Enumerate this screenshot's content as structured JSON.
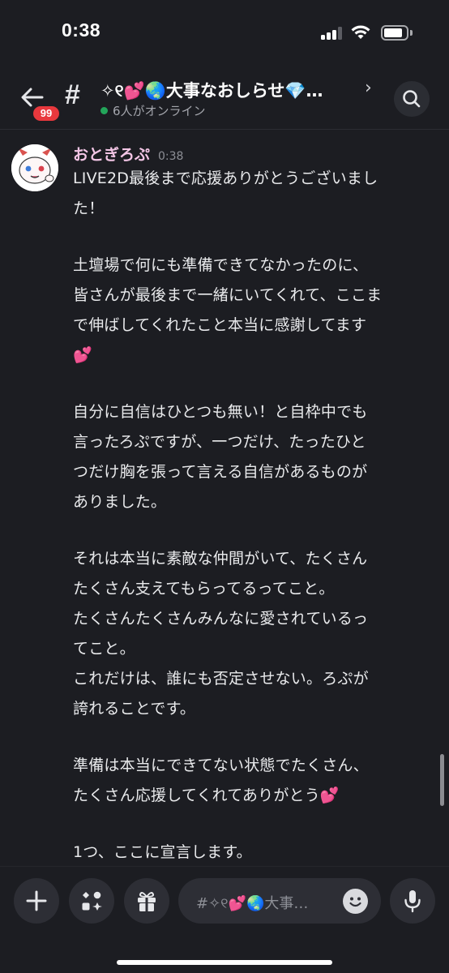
{
  "status_bar": {
    "time": "0:38"
  },
  "header": {
    "unread_badge": "99",
    "channel_name": "✧୧💕🌏大事なおしらせ💎…",
    "online_text": "6人がオンライン"
  },
  "message": {
    "author": "おとぎろぷ",
    "timestamp": "0:38",
    "paragraphs": [
      [
        "LIVE2D最後まで応援ありがとうございまし",
        "た！"
      ],
      [
        "土壇場で何にも準備できてなかったのに、",
        "皆さんが最後まで一緒にいてくれて、ここま",
        "で伸ばしてくれたこと本当に感謝してます",
        "💕"
      ],
      [
        "自分に自信はひとつも無い！と自枠中でも",
        "言ったろぷですが、一つだけ、たったひと",
        "つだけ胸を張って言える自信があるものが",
        "ありました。"
      ],
      [
        "それは本当に素敵な仲間がいて、たくさん",
        "たくさん支えてもらってるってこと。",
        "たくさんたくさんみんなに愛されているっ",
        "てこと。",
        "これだけは、誰にも否定させない。ろぷが",
        "誇れることです。"
      ],
      [
        "準備は本当にできてない状態でたくさん、",
        "たくさん応援してくれてありがとう💕"
      ],
      [
        "1つ、ここに宣言します。"
      ]
    ]
  },
  "composer": {
    "placeholder": "#✧୧💕🌏大事…",
    "icons": [
      "plus-icon",
      "apps-icon",
      "gift-icon",
      "emoji-icon",
      "microphone-icon"
    ]
  },
  "colors": {
    "background": "#1c1d22",
    "author": "#f3c6e6",
    "badge": "#e8383d",
    "online": "#23a55a"
  }
}
